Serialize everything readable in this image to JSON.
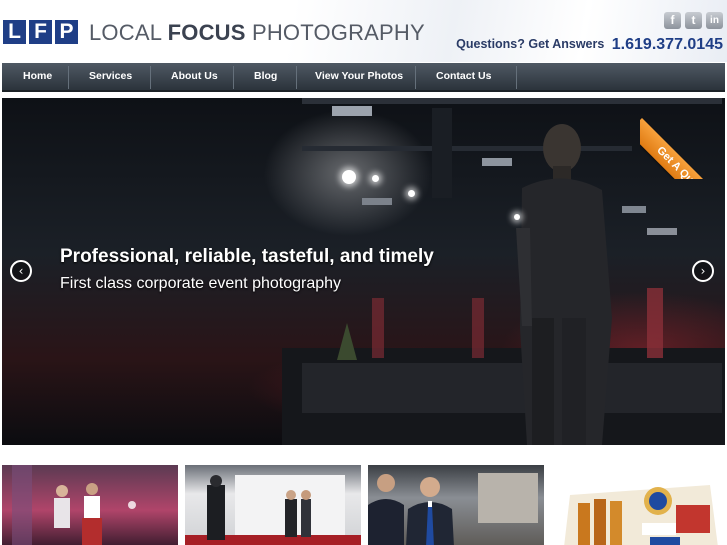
{
  "header": {
    "logo_letters": [
      "L",
      "F",
      "P"
    ],
    "brand_regular_1": "LOCAL ",
    "brand_bold": "FOCUS",
    "brand_regular_2": " PHOTOGRAPHY",
    "questions_text": "Questions? Get Answers",
    "phone": "1.619.377.0145",
    "social": [
      {
        "icon": "facebook-icon",
        "glyph": "f"
      },
      {
        "icon": "twitter-icon",
        "glyph": "t"
      },
      {
        "icon": "linkedin-icon",
        "glyph": "in"
      }
    ]
  },
  "nav": {
    "items": [
      "Home",
      "Services",
      "About Us",
      "Blog",
      "View Your Photos",
      "Contact Us"
    ]
  },
  "hero": {
    "headline": "Professional, reliable, tasteful, and timely",
    "subline": "First class corporate event photography",
    "prev_glyph": "‹",
    "next_glyph": "›",
    "quote_ribbon": "Get A Quote"
  },
  "colors": {
    "brand_blue": "#1f3e86",
    "nav_dark": "#2b333b",
    "ribbon_orange": "#e07b13"
  },
  "thumbnails": [
    "event-dance-thumbnail",
    "red-carpet-thumbnail",
    "portrait-thumbnail",
    "product-thumbnail"
  ]
}
